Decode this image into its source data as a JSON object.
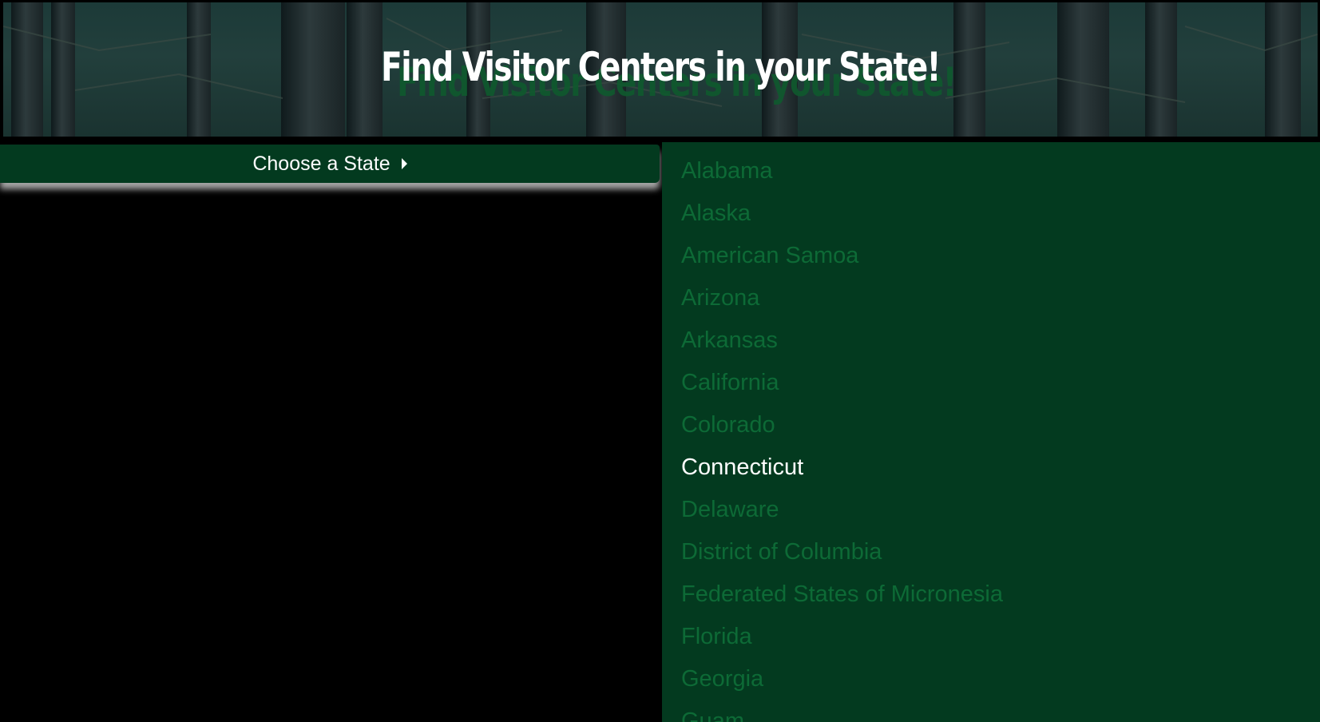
{
  "header": {
    "title": "Find Visitor Centers in your State!"
  },
  "chooser": {
    "label": "Choose a State",
    "arrow_icon": "caret-right-icon"
  },
  "states": {
    "active": "Connecticut",
    "items": [
      "Alabama",
      "Alaska",
      "American Samoa",
      "Arizona",
      "Arkansas",
      "California",
      "Colorado",
      "Connecticut",
      "Delaware",
      "District of Columbia",
      "Federated States of Micronesia",
      "Florida",
      "Georgia",
      "Guam"
    ]
  },
  "colors": {
    "panel_bg": "#033a1f",
    "item_text": "#0d6a36",
    "active_text": "#ffffff",
    "page_bg": "#000000"
  }
}
